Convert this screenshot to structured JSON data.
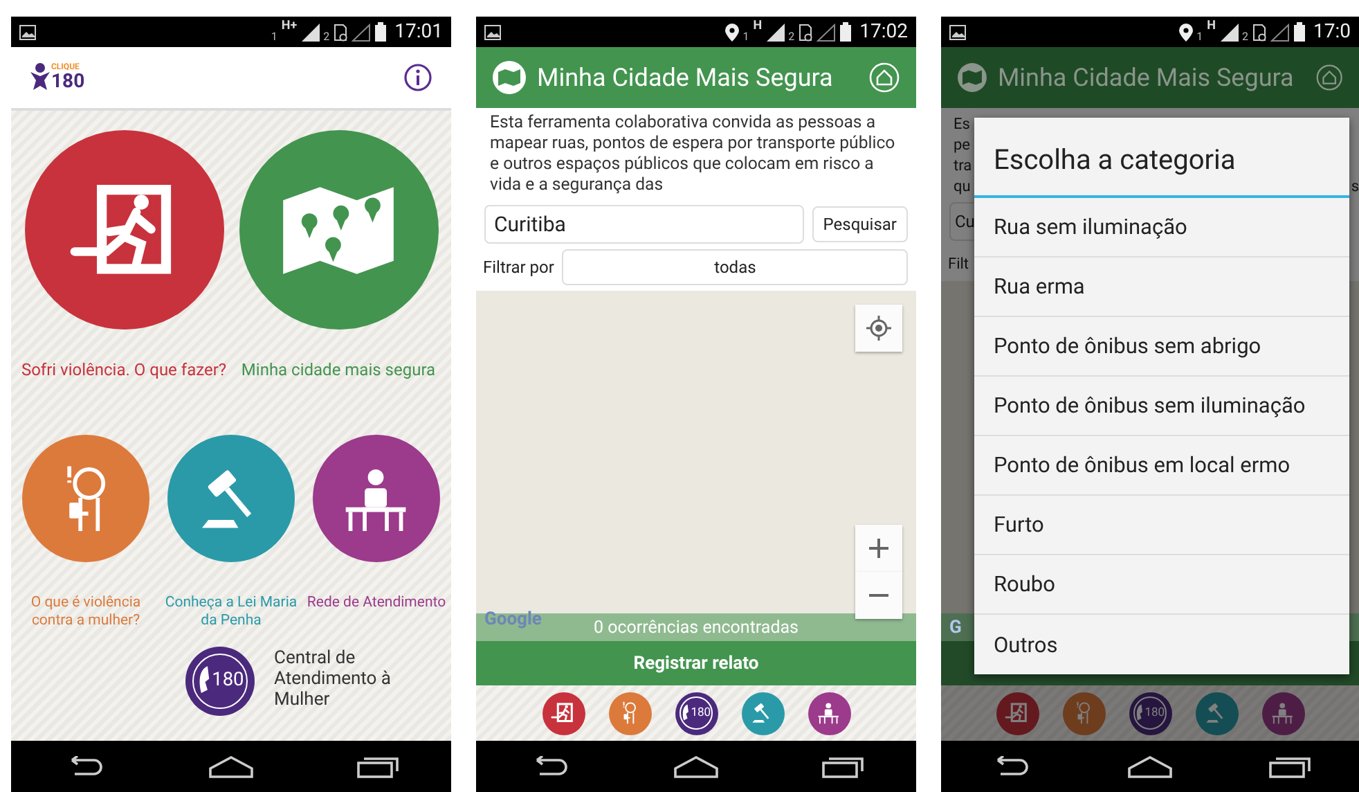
{
  "screens": [
    {
      "kind": "home",
      "status": {
        "location": false,
        "sim1": "1",
        "network": "H+",
        "sim2": "2",
        "time": "17:01"
      },
      "header": {
        "logo_small": "CLIQUE",
        "logo_big": "180"
      },
      "tiles": [
        {
          "kind": "exit",
          "color": "#c8323c",
          "label": "Sofri violência. O que fazer?"
        },
        {
          "kind": "map",
          "color": "#43944f",
          "label": "Minha cidade mais segura"
        }
      ],
      "small_tiles": [
        {
          "kind": "woman",
          "color": "#dc7a3c",
          "label": "O que é violência contra a mulher?"
        },
        {
          "kind": "gavel",
          "color": "#2a9aa8",
          "label": "Conheça a Lei Maria da Penha"
        },
        {
          "kind": "desk",
          "color": "#9c3a8c",
          "label": "Rede de Atendimento"
        }
      ],
      "hotline": {
        "badge": "180",
        "label": "Central de Atendimento à Mulher"
      }
    },
    {
      "kind": "map",
      "status": {
        "location": true,
        "sim1": "1",
        "network": "H",
        "sim2": "2",
        "time": "17:02"
      },
      "title": "Minha Cidade Mais Segura",
      "intro": "Esta ferramenta colaborativa convida as pessoas a mapear ruas, pontos de espera por transporte público e outros espaços públicos que colocam em risco a vida e a segurança das",
      "search": {
        "value": "Curitiba",
        "button": "Pesquisar"
      },
      "filter": {
        "label": "Filtrar por",
        "value": "todas"
      },
      "attribution": "Google",
      "results": "0 ocorrências encontradas",
      "report_button": "Registrar relato",
      "shortcuts": [
        {
          "kind": "exit",
          "color": "#c8323c"
        },
        {
          "kind": "woman",
          "color": "#dc7a3c"
        },
        {
          "kind": "hotline",
          "color": "#4b2a7d",
          "badge": "180"
        },
        {
          "kind": "gavel",
          "color": "#2a9aa8"
        },
        {
          "kind": "desk",
          "color": "#9c3a8c"
        }
      ]
    },
    {
      "kind": "dialog",
      "status": {
        "location": true,
        "sim1": "1",
        "network": "H",
        "sim2": "2",
        "time": "17:0"
      },
      "title": "Minha Cidade Mais Segura",
      "left_fragments": [
        "Es",
        "pe",
        "tra",
        "qu"
      ],
      "right_fragment": "s",
      "search_fragment": "Cu",
      "filter_fragment": "Filt",
      "attribution_fragment": "G",
      "dialog": {
        "title": "Escolha a categoria",
        "options": [
          "Rua sem iluminação",
          "Rua erma",
          "Ponto de ônibus sem abrigo",
          "Ponto de ônibus sem iluminação",
          "Ponto de ônibus em local ermo",
          "Furto",
          "Roubo",
          "Outros"
        ]
      },
      "shortcuts": [
        {
          "kind": "exit",
          "color": "#64191e"
        },
        {
          "kind": "woman",
          "color": "#6e3d1e"
        },
        {
          "kind": "hotline",
          "color": "#26153f",
          "badge": "180"
        },
        {
          "kind": "gavel",
          "color": "#154d54"
        },
        {
          "kind": "desk",
          "color": "#4e1d46"
        }
      ]
    }
  ]
}
